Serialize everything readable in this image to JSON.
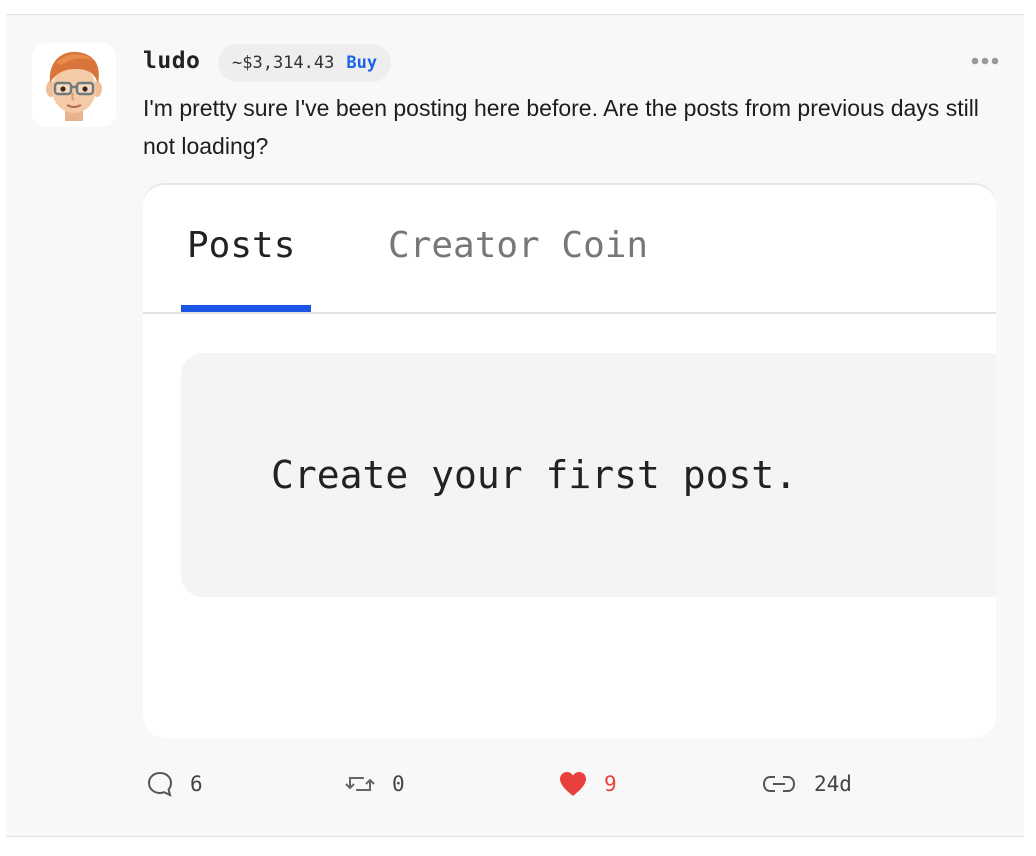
{
  "post": {
    "username": "ludo",
    "coin_price": "~$3,314.43",
    "buy_label": "Buy",
    "body": "I'm pretty sure I've been posting here before. Are the posts from previous days still not loading?"
  },
  "embed": {
    "tabs": [
      "Posts",
      "Creator Coin"
    ],
    "active_tab": "Posts",
    "empty_message": "Create your first post."
  },
  "actions": {
    "comments": "6",
    "reposts": "0",
    "likes": "9",
    "age": "24d"
  },
  "colors": {
    "accent": "#1b55e8",
    "like": "#e8403d",
    "card_bg": "#f8f8f8"
  },
  "icons": [
    "avatar",
    "more-icon",
    "comment-icon",
    "repost-icon",
    "heart-icon",
    "link-icon"
  ]
}
